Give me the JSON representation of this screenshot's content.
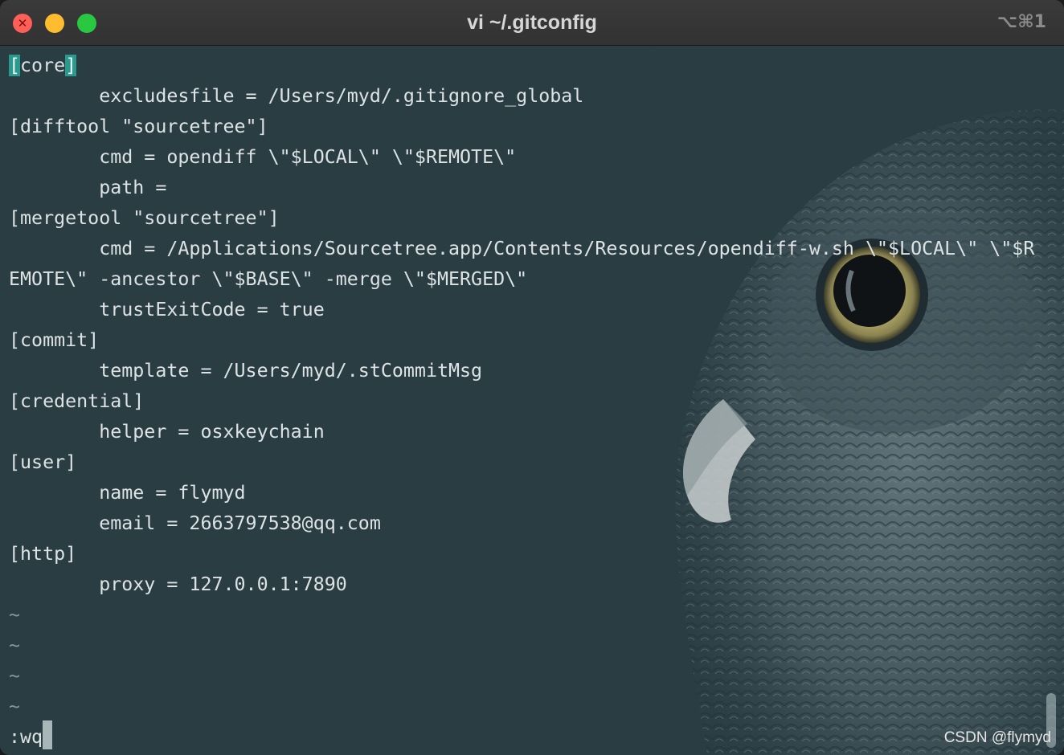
{
  "window": {
    "title": "vi ~/.gitconfig",
    "shortcut": "⌥⌘1",
    "close_icon": "close-icon",
    "colors": {
      "background": "#2a3d43",
      "highlight": "#2a9a8f",
      "text": "#dde3e4"
    }
  },
  "editor": {
    "first_line": {
      "open": "[",
      "word": "core",
      "close": "]"
    },
    "lines": [
      "        excludesfile = /Users/myd/.gitignore_global",
      "[difftool \"sourcetree\"]",
      "        cmd = opendiff \\\"$LOCAL\\\" \\\"$REMOTE\\\"",
      "        path =",
      "[mergetool \"sourcetree\"]",
      "        cmd = /Applications/Sourcetree.app/Contents/Resources/opendiff-w.sh \\\"$LOCAL\\\" \\\"$R",
      "EMOTE\\\" -ancestor \\\"$BASE\\\" -merge \\\"$MERGED\\\"",
      "        trustExitCode = true",
      "[commit]",
      "        template = /Users/myd/.stCommitMsg",
      "[credential]",
      "        helper = osxkeychain",
      "[user]",
      "        name = flymyd",
      "        email = 2663797538@qq.com",
      "[http]",
      "        proxy = 127.0.0.1:7890"
    ],
    "tilde_lines": [
      "~",
      "~",
      "~",
      "~"
    ],
    "command_line": ":wq"
  },
  "watermark": "CSDN @flymyd",
  "background_image": "owl-illustration"
}
